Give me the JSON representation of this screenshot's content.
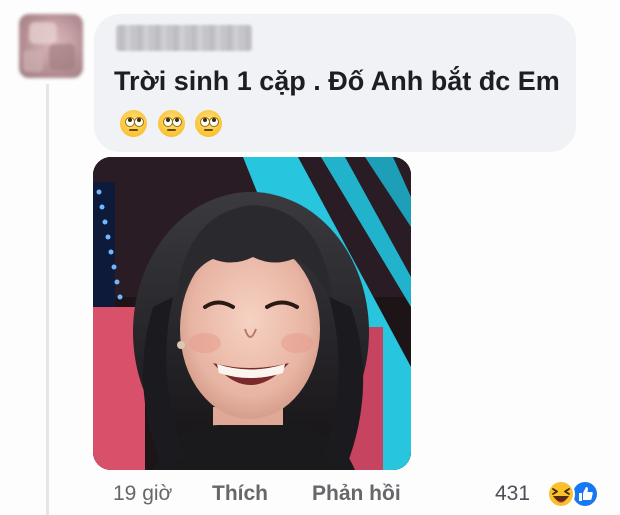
{
  "comment": {
    "author_name": "",
    "text": "Trời sinh 1 cặp . Đố Anh bắt đc Em",
    "emojis": [
      "face-with-rolling-eyes",
      "face-with-rolling-eyes",
      "face-with-rolling-eyes"
    ]
  },
  "attachment": {
    "type": "photo",
    "description": "smiling woman with dark wavy hair and bangs"
  },
  "actions": {
    "time": "19 giờ",
    "like_label": "Thích",
    "reply_label": "Phản hồi",
    "reaction_count": "431",
    "reaction_icons": [
      "haha-icon",
      "like-icon"
    ]
  },
  "colors": {
    "bubble": "#f0f2f5",
    "text": "#1c1e21",
    "meta": "#65676b",
    "like_blue": "#1877f2",
    "haha_yellow": "#fbc02d"
  }
}
